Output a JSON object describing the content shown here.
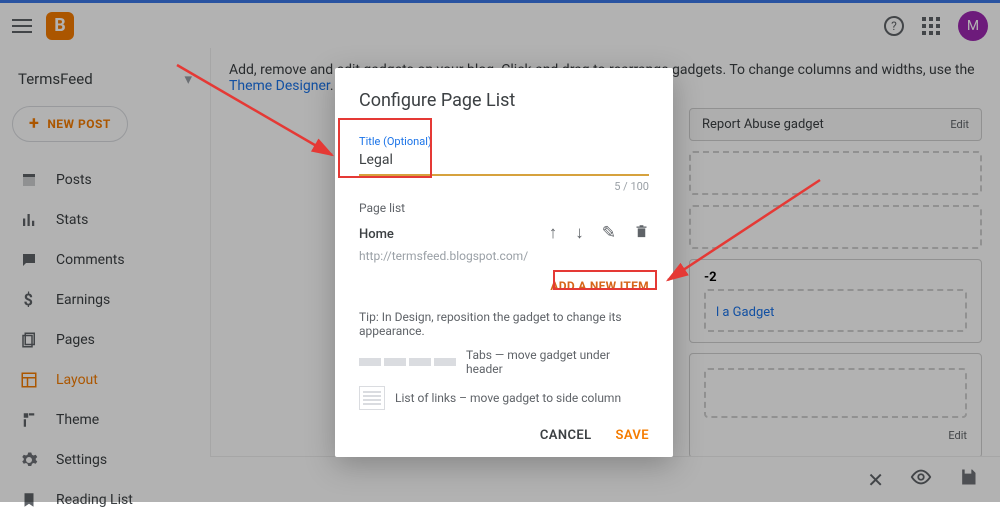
{
  "header": {
    "avatar_letter": "M"
  },
  "sidebar": {
    "blog_name": "TermsFeed",
    "new_post_label": "NEW POST",
    "items": [
      {
        "label": "Posts"
      },
      {
        "label": "Stats"
      },
      {
        "label": "Comments"
      },
      {
        "label": "Earnings"
      },
      {
        "label": "Pages"
      },
      {
        "label": "Layout"
      },
      {
        "label": "Theme"
      },
      {
        "label": "Settings"
      },
      {
        "label": "Reading List"
      }
    ]
  },
  "main": {
    "info_prefix": "Add, remove and edit gadgets on your blog. Click and drag to rearrange gadgets. To change columns and widths, use the ",
    "theme_designer_link": "Theme Designer",
    "info_suffix": ".",
    "report_abuse_gadget": "Report Abuse gadget",
    "edit_label": "Edit",
    "section2_label": "-2",
    "add_gadget_link": "l a Gadget"
  },
  "dialog": {
    "title": "Configure Page List",
    "title_field_label": "Title (Optional)",
    "title_value": "Legal",
    "counter": "5 / 100",
    "page_list_label": "Page list",
    "home_label": "Home",
    "home_url": "http://termsfeed.blogspot.com/",
    "add_item_label": "ADD A NEW ITEM",
    "tip_text": "Tip: In Design, reposition the gadget to change its appearance.",
    "tabs_hint": "Tabs — move gadget under header",
    "list_hint": "List of links – move gadget to side column",
    "cancel_label": "CANCEL",
    "save_label": "SAVE"
  }
}
